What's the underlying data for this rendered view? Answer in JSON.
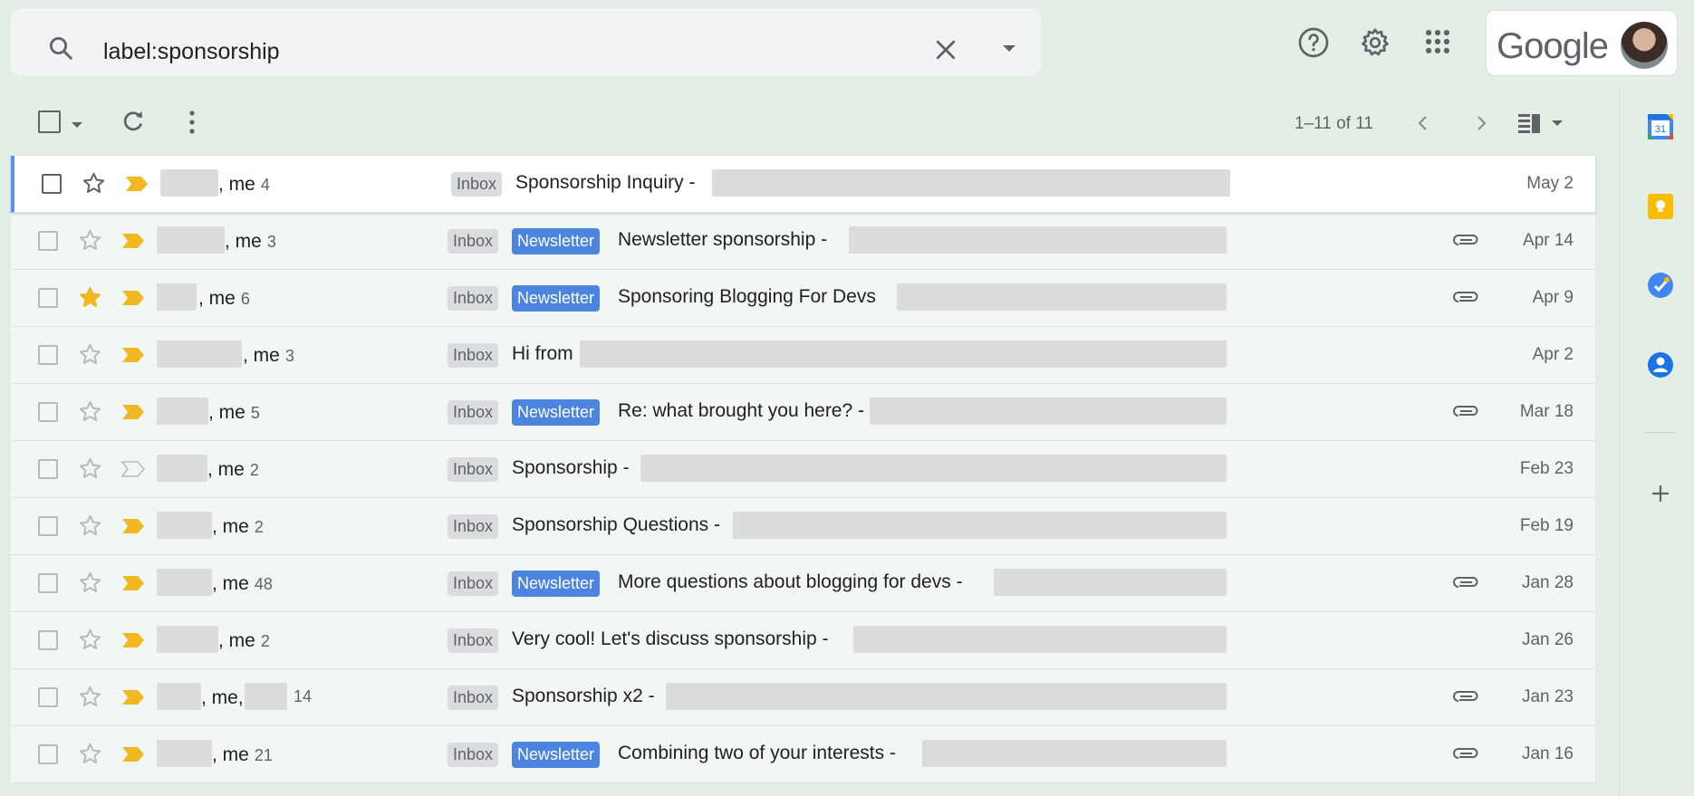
{
  "search": {
    "query": "label:sponsorship"
  },
  "account": {
    "logo_text": "Google"
  },
  "toolbar": {
    "pager": "1–11 of 11"
  },
  "colors": {
    "newsletter_label": "#4c85e0",
    "important_marker": "#f2b824",
    "starred": "#f2b824",
    "selected_row_border": "#5b8ef0",
    "background": "#e3efe5"
  },
  "icons": [
    "search-icon",
    "clear-search-icon",
    "search-options-icon",
    "help-icon",
    "settings-icon",
    "apps-icon",
    "select-all-icon",
    "refresh-icon",
    "more-icon",
    "older-icon",
    "newer-icon",
    "split-pane-icon",
    "calendar-icon",
    "keep-icon",
    "tasks-icon",
    "contacts-icon",
    "add-icon",
    "attachment-icon",
    "star-icon",
    "importance-icon"
  ],
  "emails": [
    {
      "sender": ", me",
      "count": "4",
      "label": "Inbox",
      "newsletter": "",
      "subject": "Sponsorship Inquiry -",
      "date": "May 2",
      "starred": false,
      "important": true,
      "attachment": false
    },
    {
      "sender": ", me",
      "count": "3",
      "label": "Inbox",
      "newsletter": "Newsletter",
      "subject": "Newsletter sponsorship -",
      "date": "Apr 14",
      "starred": false,
      "important": true,
      "attachment": true
    },
    {
      "sender": ", me",
      "count": "6",
      "label": "Inbox",
      "newsletter": "Newsletter",
      "subject": "Sponsoring Blogging For Devs",
      "date": "Apr 9",
      "starred": true,
      "important": true,
      "attachment": true
    },
    {
      "sender": ", me",
      "count": "3",
      "label": "Inbox",
      "newsletter": "",
      "subject": "Hi from",
      "date": "Apr 2",
      "starred": false,
      "important": true,
      "attachment": false
    },
    {
      "sender": ", me",
      "count": "5",
      "label": "Inbox",
      "newsletter": "Newsletter",
      "subject": "Re: what brought you here? -",
      "date": "Mar 18",
      "starred": false,
      "important": true,
      "attachment": true
    },
    {
      "sender": ", me",
      "count": "2",
      "label": "Inbox",
      "newsletter": "",
      "subject": "Sponsorship -",
      "date": "Feb 23",
      "starred": false,
      "important": false,
      "attachment": false
    },
    {
      "sender": ", me",
      "count": "2",
      "label": "Inbox",
      "newsletter": "",
      "subject": "Sponsorship Questions -",
      "date": "Feb 19",
      "starred": false,
      "important": true,
      "attachment": false
    },
    {
      "sender": ", me",
      "count": "48",
      "label": "Inbox",
      "newsletter": "Newsletter",
      "subject": "More questions about blogging for devs -",
      "date": "Jan 28",
      "starred": false,
      "important": true,
      "attachment": true
    },
    {
      "sender": ", me",
      "count": "2",
      "label": "Inbox",
      "newsletter": "",
      "subject": "Very cool! Let's discuss sponsorship -",
      "date": "Jan 26",
      "starred": false,
      "important": true,
      "attachment": false
    },
    {
      "sender": ", me,",
      "count": "14",
      "label": "Inbox",
      "newsletter": "",
      "subject": "Sponsorship x2 -",
      "date": "Jan 23",
      "starred": false,
      "important": true,
      "attachment": true
    },
    {
      "sender": ", me",
      "count": "21",
      "label": "Inbox",
      "newsletter": "Newsletter",
      "subject": "Combining two of your interests -",
      "date": "Jan 16",
      "starred": false,
      "important": true,
      "attachment": true
    }
  ]
}
